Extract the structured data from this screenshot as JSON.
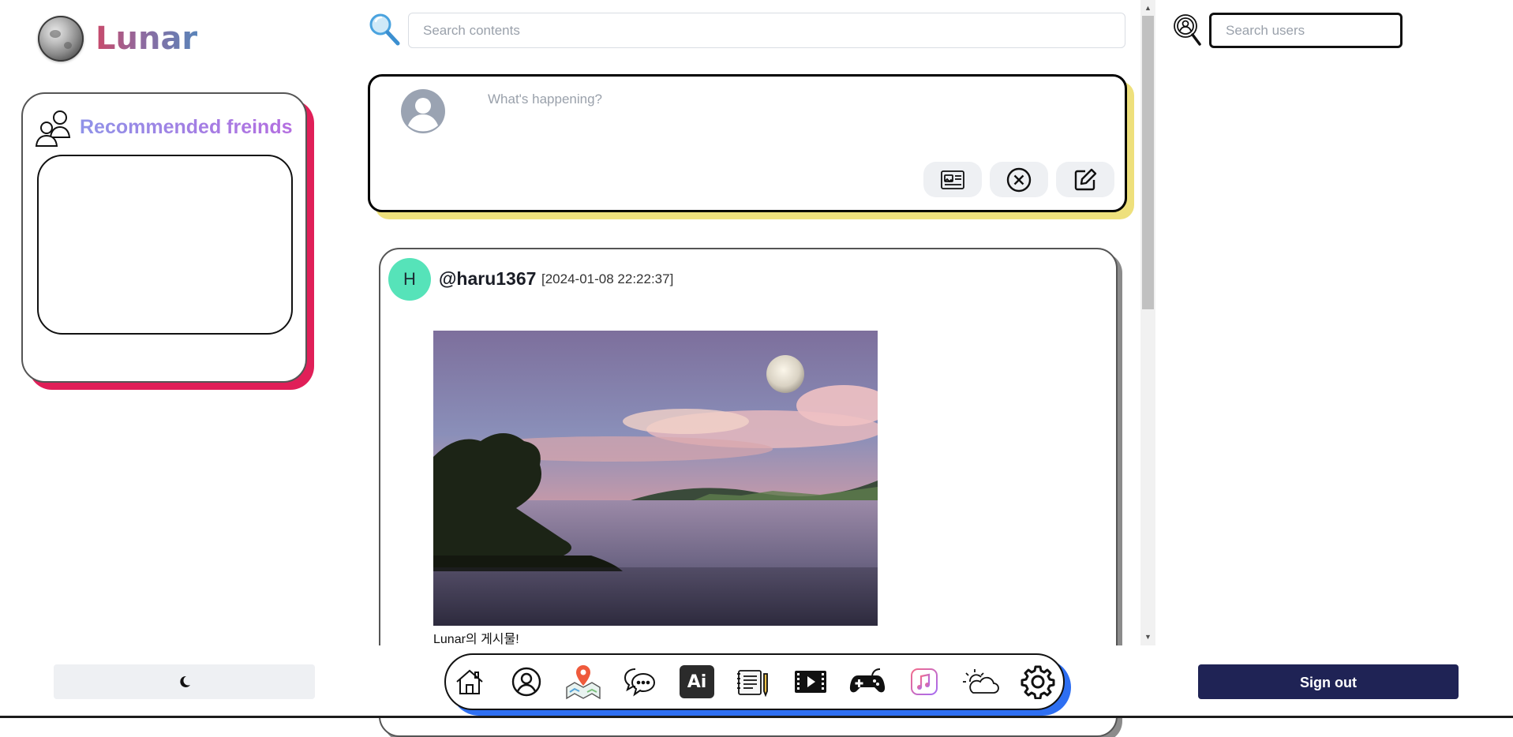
{
  "app": {
    "name": "Lunar"
  },
  "recommended": {
    "title": "Recommended freinds"
  },
  "search": {
    "contents_placeholder": "Search contents",
    "users_placeholder": "Search users"
  },
  "composer": {
    "placeholder": "What's happening?",
    "buttons": [
      "attach-media",
      "cancel",
      "write-post"
    ]
  },
  "post": {
    "avatar_initial": "H",
    "username": "@haru1367",
    "timestamp": "[2024-01-08 22:22:37]",
    "caption": "Lunar의 게시물!"
  },
  "dock": {
    "items": [
      "home",
      "profile",
      "map",
      "chat",
      "ai",
      "notes",
      "video",
      "game",
      "music",
      "weather",
      "settings"
    ],
    "ai_label": "Ai"
  },
  "footer": {
    "signout_label": "Sign out"
  },
  "colors": {
    "rec_shadow": "#e01f58",
    "composer_shadow": "#eee07c",
    "dock_shadow": "#2e6ff2",
    "signout_bg": "#1f2355",
    "avatar_bg": "#56e3b9"
  }
}
